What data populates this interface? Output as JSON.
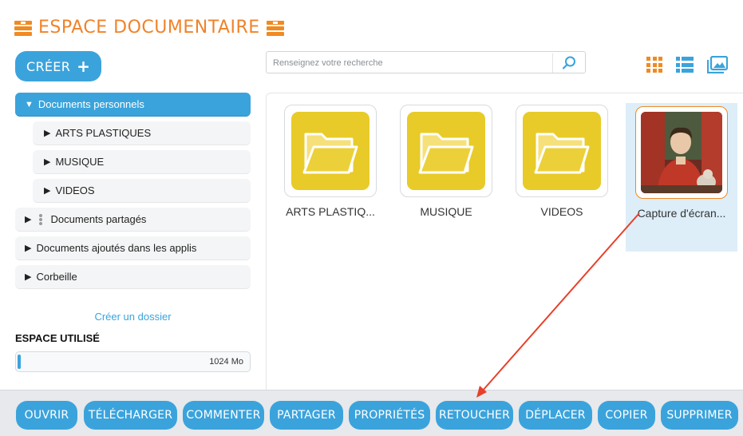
{
  "header": {
    "title": "ESPACE DOCUMENTAIRE",
    "icon": "archive-box-icon",
    "accent_color": "#f0832a"
  },
  "create_button": {
    "label": "CRÉER",
    "icon": "plus-icon"
  },
  "search": {
    "placeholder": "Renseignez votre recherche",
    "icon": "search-icon"
  },
  "view_modes": [
    {
      "name": "grid-view-icon",
      "active": true
    },
    {
      "name": "list-view-icon",
      "active": false
    },
    {
      "name": "image-view-icon",
      "active": false
    }
  ],
  "sidebar": {
    "items": [
      {
        "label": "Documents personnels",
        "arrow": "▼",
        "level": 0,
        "active": true
      },
      {
        "label": "ARTS PLASTIQUES",
        "arrow": "▶",
        "level": 1
      },
      {
        "label": "MUSIQUE",
        "arrow": "▶",
        "level": 1
      },
      {
        "label": "VIDEOS",
        "arrow": "▶",
        "level": 1
      },
      {
        "label": "Documents partagés",
        "arrow": "▶",
        "level": 0,
        "icon": "share-icon"
      },
      {
        "label": "Documents ajoutés dans les applis",
        "arrow": "▶",
        "level": 0
      },
      {
        "label": "Corbeille",
        "arrow": "▶",
        "level": 0
      }
    ],
    "create_folder": "Créer un dossier",
    "space_label": "ESPACE UTILISÉ",
    "storage_value": "1024 Mo",
    "storage_fraction": 0.01
  },
  "content": {
    "items": [
      {
        "label": "ARTS PLASTIQ...",
        "type": "folder"
      },
      {
        "label": "MUSIQUE",
        "type": "folder"
      },
      {
        "label": "VIDEOS",
        "type": "folder"
      },
      {
        "label": "Capture d'écran...",
        "type": "image",
        "selected": true
      }
    ]
  },
  "toolbar": {
    "buttons": [
      "OUVRIR",
      "TÉLÉCHARGER",
      "COMMENTER",
      "PARTAGER",
      "PROPRIÉTÉS",
      "RETOUCHER",
      "DÉPLACER",
      "COPIER",
      "SUPPRIMER"
    ]
  },
  "annotation": {
    "arrow_color": "#e8402a"
  },
  "colors": {
    "primary": "#3ba3dc",
    "folder": "#e8cb28",
    "accent": "#f08a22"
  }
}
